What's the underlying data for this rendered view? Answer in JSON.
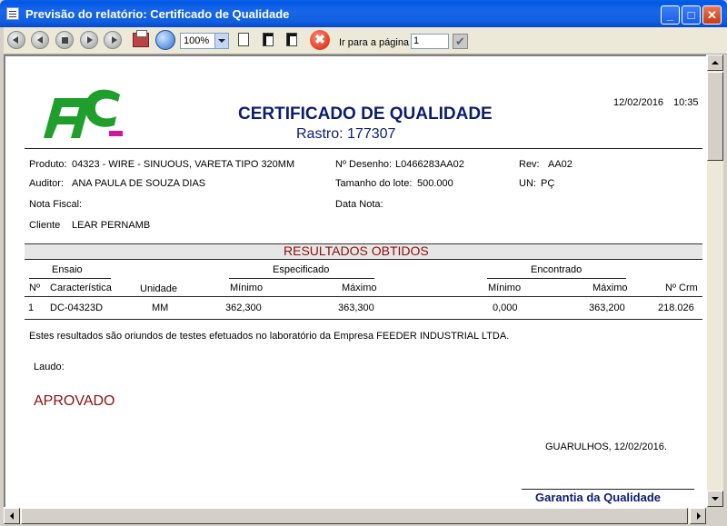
{
  "window": {
    "title": "Previsão do relatório: Certificado de Qualidade",
    "minimize_label": "_",
    "maximize_label": "□",
    "close_label": "✕"
  },
  "toolbar": {
    "zoom": "100%",
    "goto_label": "Ir para a página",
    "page_value": "1",
    "cancel_glyph": "✖",
    "confirm_glyph": "✔"
  },
  "report": {
    "logo_text": "FFC",
    "title": "CERTIFICADO DE QUALIDADE",
    "rastro": "Rastro: 177307",
    "date": "12/02/2016",
    "time": "10:35",
    "fields": {
      "produto_label": "Produto:",
      "produto_value": "04323 - WIRE - SINUOUS, VARETA TIPO 320MM",
      "desenho_label": "Nº Desenho:",
      "desenho_value": "L0466283AA02",
      "rev_label": "Rev:",
      "rev_value": "AA02",
      "auditor_label": "Auditor:",
      "auditor_value": "ANA PAULA DE SOUZA DIAS",
      "lote_label": "Tamanho do lote:",
      "lote_value": "500.000",
      "un_label": "UN:",
      "un_value": "PÇ",
      "nota_fiscal_label": "Nota Fiscal:",
      "data_nota_label": "Data Nota:",
      "cliente_label": "Cliente",
      "cliente_value": "LEAR PERNAMB"
    },
    "section_title": "RESULTADOS OBTIDOS",
    "table": {
      "group_ensaio": "Ensaio",
      "group_especificado": "Especificado",
      "group_encontrado": "Encontrado",
      "col_num": "Nº",
      "col_caracteristica": "Característica",
      "col_unidade": "Unidade",
      "col_minimo_esp": "Mínimo",
      "col_maximo_esp": "Máximo",
      "col_minimo_enc": "Mínimo",
      "col_maximo_enc": "Máximo",
      "col_crm": "Nº Crm",
      "rows": [
        {
          "num": "1",
          "caracteristica": "DC-04323D",
          "unidade": "MM",
          "min_esp": "362,300",
          "max_esp": "363,300",
          "min_enc": "0,000",
          "max_enc": "363,200",
          "crm": "218.026"
        }
      ]
    },
    "note": "Estes resultados são oriundos de testes efetuados no laboratório da Empresa FEEDER INDUSTRIAL LTDA.",
    "laudo_label": "Laudo:",
    "laudo_value": "APROVADO",
    "place_date": "GUARULHOS, 12/02/2016.",
    "signature": "Garantia da Qualidade"
  },
  "colors": {
    "title_blue": "#0a1d6e",
    "red": "#8b1010",
    "logo_green": "#1e9e2a",
    "logo_magenta": "#d4169c"
  }
}
